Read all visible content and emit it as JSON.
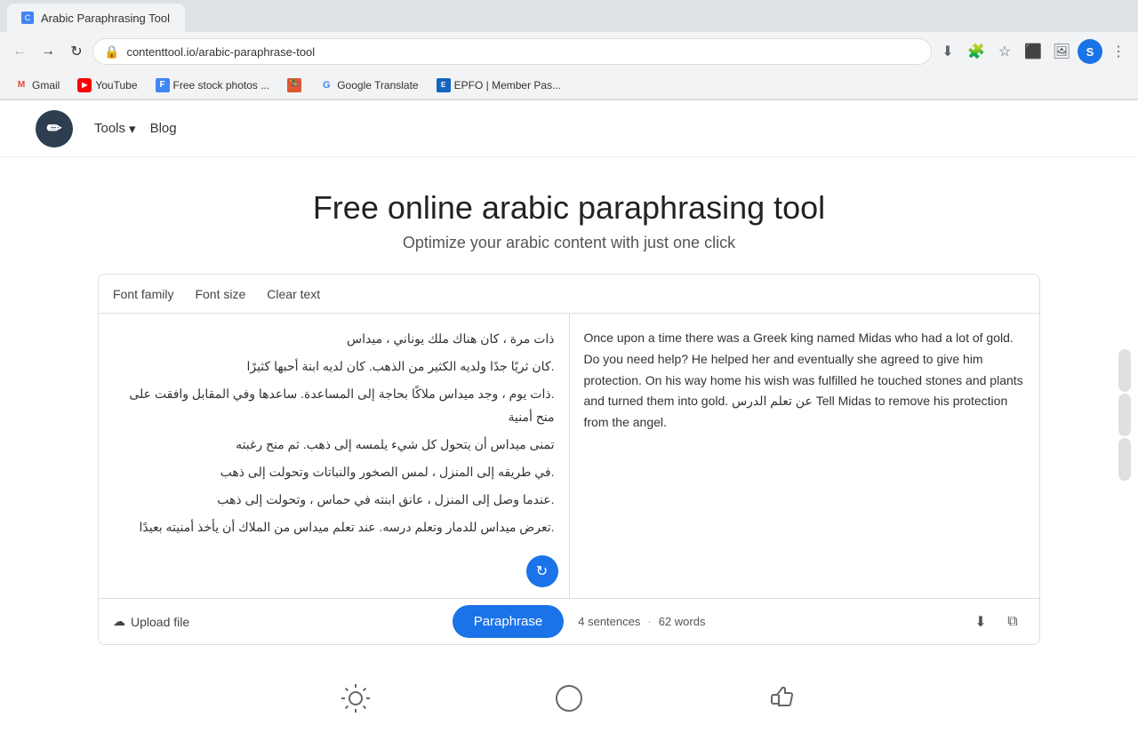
{
  "browser": {
    "tab_title": "Arabic Paraphrasing Tool",
    "address": "contenttool.io/arabic-paraphrase-tool",
    "nav": {
      "back_title": "Back",
      "forward_title": "Forward",
      "reload_title": "Reload",
      "download_title": "Download",
      "extensions_title": "Extensions",
      "bookmark_title": "Bookmark",
      "puzzle_title": "Extensions",
      "profile_label": "S"
    }
  },
  "bookmarks": [
    {
      "id": "gmail",
      "label": "Gmail",
      "icon_type": "gmail"
    },
    {
      "id": "youtube",
      "label": "YouTube",
      "icon_type": "yt"
    },
    {
      "id": "free-stock",
      "label": "Free stock photos ...",
      "icon_type": "blue"
    },
    {
      "id": "sep1",
      "label": "",
      "icon_type": "duck"
    },
    {
      "id": "google-translate",
      "label": "Google Translate",
      "icon_type": "google"
    },
    {
      "id": "epfo",
      "label": "EPFO | Member Pas...",
      "icon_type": "epfo"
    }
  ],
  "site": {
    "logo_letter": "✏",
    "nav_tools": "Tools",
    "nav_blog": "Blog"
  },
  "hero": {
    "title": "Free online arabic paraphrasing tool",
    "subtitle": "Optimize your arabic content with just one click"
  },
  "toolbar": {
    "font_family": "Font family",
    "font_size": "Font size",
    "clear_text": "Clear text"
  },
  "input_text": {
    "lines": [
      "ذات مرة ، كان هناك ملك يوناني ، ميداس",
      ".كان ثريًا جدًا ولديه الكثير من الذهب. كان لديه ابنة أحبها كثيرًا",
      ".ذات يوم ، وجد ميداس ملاكًا بحاجة إلى المساعدة. ساعدها وفي المقابل وافقت على منح أمنية",
      "تمنى ميداس أن يتحول كل شيء يلمسه إلى ذهب. ثم منح رغبته",
      ".في طريقه إلى المنزل ، لمس الصخور والنباتات وتحولت إلى ذهب",
      ".عندما وصل إلى المنزل ، عانق ابنته في حماس ، وتحولت إلى ذهب",
      ".تعرض ميداس للدمار وتعلم درسه. عند تعلم ميداس من الملاك أن يأخذ أمنيته بعيدًا"
    ]
  },
  "output_text": "Once upon a time there was a Greek king named Midas who had a lot of gold. Do you need help? He helped her and eventually she agreed to give him protection. On his way home his wish was fulfilled he touched stones and plants and turned them into gold. عن تعلم الدرس Tell Midas to remove his protection from the angel.",
  "bottom_bar": {
    "upload_label": "Upload file",
    "paraphrase_btn": "Paraphrase",
    "sentence_count": "4 sentences",
    "word_count": "62 words"
  },
  "features": [
    {
      "id": "feature-1",
      "icon": "☀",
      "label": ""
    },
    {
      "id": "feature-2",
      "icon": "◯",
      "label": ""
    },
    {
      "id": "feature-3",
      "icon": "👍",
      "label": ""
    }
  ]
}
